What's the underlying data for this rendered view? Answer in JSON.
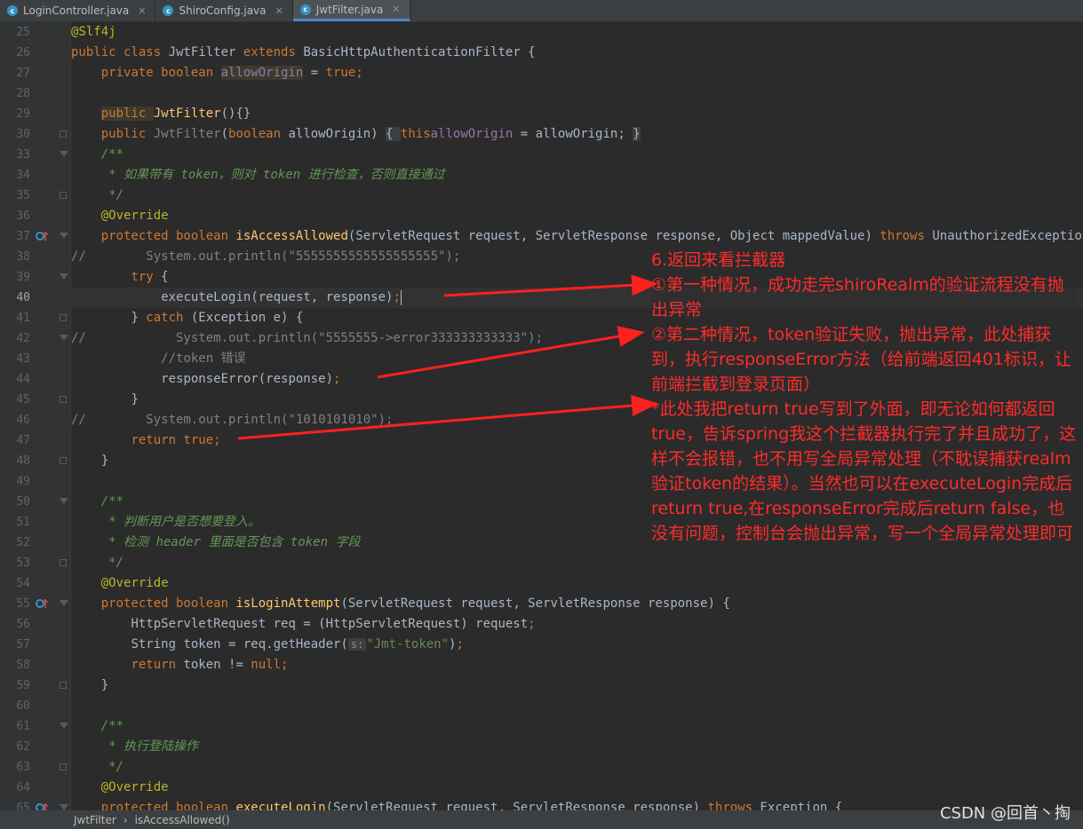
{
  "tabs": [
    {
      "label": "LoginController.java",
      "icon": "class-c-icon"
    },
    {
      "label": "ShiroConfig.java",
      "icon": "class-c-icon"
    },
    {
      "label": "JwtFilter.java",
      "icon": "class-c-icon",
      "active": true
    }
  ],
  "gutter": {
    "numbers": [
      "25",
      "26",
      "27",
      "28",
      "29",
      "30",
      "33",
      "34",
      "35",
      "36",
      "37",
      "38",
      "39",
      "40",
      "41",
      "42",
      "43",
      "44",
      "45",
      "46",
      "47",
      "48",
      "49",
      "50",
      "51",
      "52",
      "53",
      "54",
      "55",
      "56",
      "57",
      "58",
      "59",
      "60",
      "61",
      "62",
      "63",
      "64",
      "65"
    ]
  },
  "code": {
    "l25_ann": "@Slf4j",
    "l26_kw1": "public class ",
    "l26_name": "JwtFilter ",
    "l26_kw2": "extends ",
    "l26_rest": "BasicHttpAuthenticationFilter {",
    "l27_kw": "private boolean ",
    "l27_field": "allowOrigin",
    "l27_eq": " = ",
    "l27_true": "true",
    "l27_semi": ";",
    "l29_kw": "public ",
    "l29_name": "JwtFilter",
    "l29_rest": "(){}",
    "l30_kw": "public ",
    "l30_name": "JwtFilter",
    "l30_p1": "(",
    "l30_bool": "boolean ",
    "l30_p2": "allowOrigin) ",
    "l30_ob": "{ ",
    "l30_this": "this",
    ".dot": ".",
    "l30_field": "allowOrigin",
    "l30_rest": " = allowOrigin; ",
    "l30_cb": "}",
    "l33": "/**",
    "l34_a": " * 如果带有 ",
    "l34_b": "token",
    "l34_c": "，则对 ",
    "l34_d": "token",
    "l34_e": " 进行检查，否则直接通过",
    "l35": " */",
    "l36": "@Override",
    "l37_kw": "protected boolean ",
    "l37_name": "isAccessAllowed",
    "l37_rest": "(ServletRequest request, ServletResponse response, Object mappedValue) ",
    "l37_throws": "throws ",
    "l37_exc": "UnauthorizedException {",
    "l38": "//        System.out.println(\"5555555555555555555\");",
    "l39_kw": "try ",
    "l39_rest": "{",
    "l40": "executeLogin(request, response)",
    "l40_semi": ";",
    "l41_a": "} ",
    "l41_kw": "catch ",
    "l41_rest": "(Exception e) {",
    "l42": "//            System.out.println(\"5555555->error333333333333\");",
    "l43": "//token 错误",
    "l44": "responseError(response)",
    "l44_semi": ";",
    "l45": "}",
    "l46": "//        System.out.println(\"1010101010\");",
    "l47_kw": "return true",
    "l47_semi": ";",
    "l48": "}",
    "l50": "/**",
    "l51": " * 判断用户是否想要登入。",
    "l52_a": " * 检测 ",
    "l52_b": "header",
    "l52_c": " 里面是否包含 ",
    "l52_d": "token",
    "l52_e": " 字段",
    "l53": " */",
    "l54": "@Override",
    "l55_kw": "protected boolean ",
    "l55_name": "isLoginAttempt",
    "l55_rest": "(ServletRequest request, ServletResponse response) {",
    "l56": "HttpServletRequest req = (HttpServletRequest) request",
    "l56_semi": ";",
    "l57_a": "String token = req.getHeader(",
    "l57_hint": "s:",
    "l57_str": "\"Jmt-token\"",
    "l57_b": ")",
    "l57_semi": ";",
    "l58_kw": "return ",
    "l58_a": "token != ",
    "l58_null": "null",
    "l58_semi": ";",
    "l59": "}",
    "l61": "/**",
    "l62": " * 执行登陆操作",
    "l63": " */",
    "l64": "@Override",
    "l65_kw": "protected boolean ",
    "l65_name": "executeLogin",
    "l65_rest": "(ServletRequest request, ServletResponse response) ",
    "l65_throws": "throws ",
    "l65_exc": "Exception {"
  },
  "note": {
    "lines": [
      "6.返回来看拦截器",
      "①第一种情况，成功走完shiroRealm的验证流程没有抛出异常",
      "②第二种情况，token验证失败，抛出异常，此处捕获到，执行responseError方法（给前端返回401标识，让前端拦截到登录页面）",
      "*此处我把return true写到了外面，即无论如何都返回true，告诉spring我这个拦截器执行完了并且成功了，这样不会报错，也不用写全局异常处理（不耽误捕获realm验证token的结果）。当然也可以在executeLogin完成后return true,在responseError完成后return false，也没有问题，控制台会抛出异常，写一个全局异常处理即可"
    ],
    "color": "#ff2b2b"
  },
  "statusbar": {
    "crumb1": "JwtFilter",
    "sep": "›",
    "crumb2": "isAccessAllowed()"
  },
  "watermark": "CSDN @回首丶掏",
  "colors": {
    "keyword": "#cc7832",
    "annotation": "#bbb529",
    "method": "#ffc66d",
    "string": "#6a8759",
    "doc": "#629755",
    "comment": "#808080",
    "field": "#9876aa"
  }
}
